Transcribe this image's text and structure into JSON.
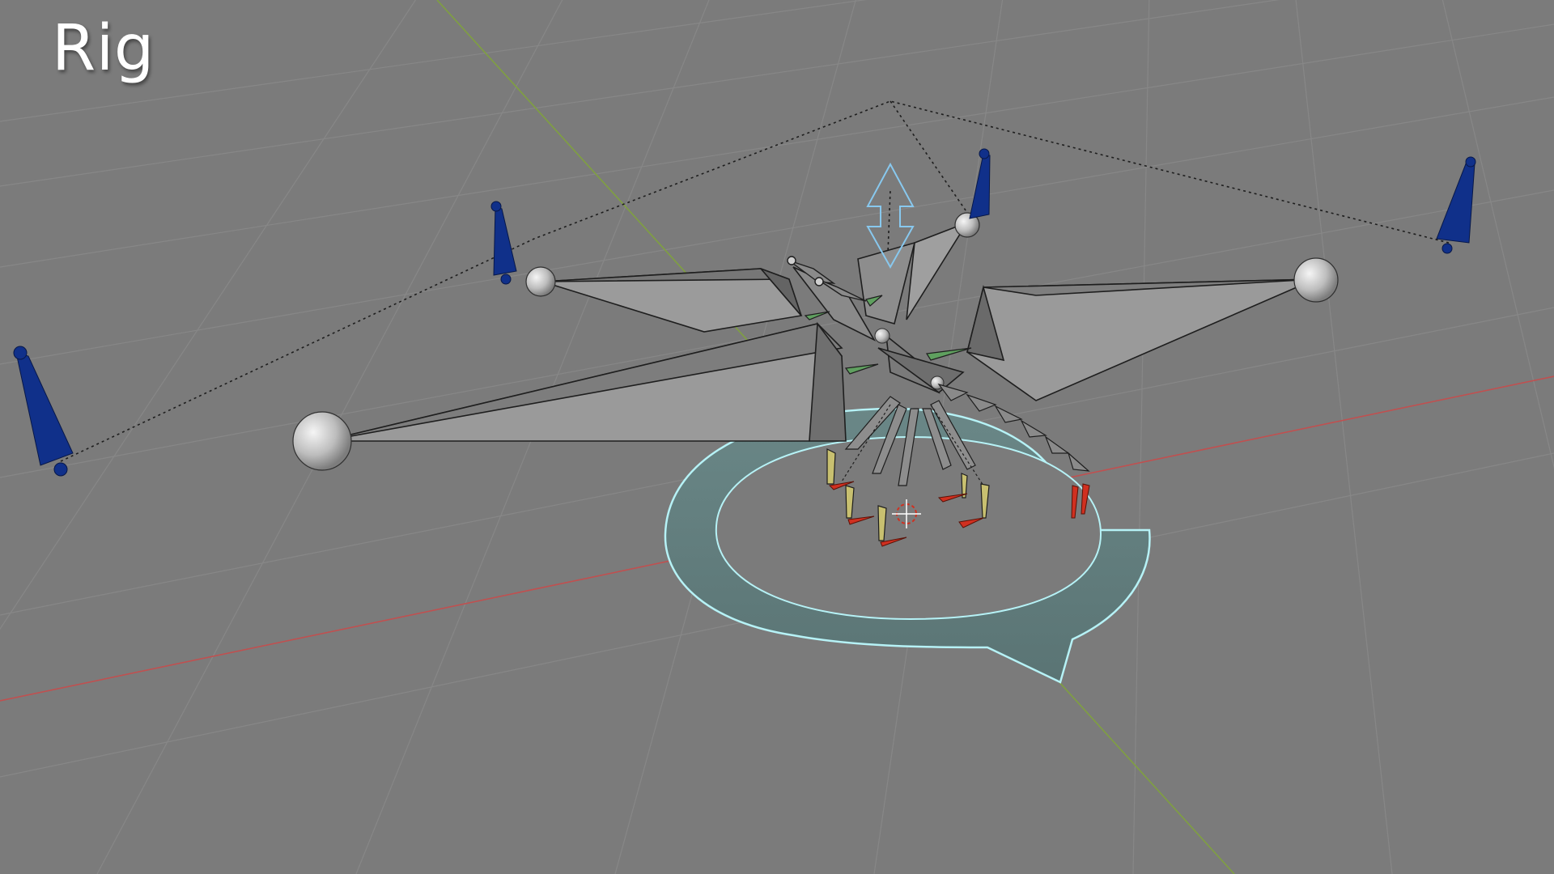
{
  "viewport": {
    "title": "Rig"
  },
  "colors": {
    "background": "#7b7b7b",
    "grid": "#8a8a8a",
    "x_axis": "#c05050",
    "y_axis": "#7fa040",
    "bone": "#8c8c8c",
    "bone_dark": "#5f5f5f",
    "joint": "#d8d8d8",
    "ik_target": "#10308a",
    "foot_control": "#d03020",
    "leg_bone": "#c8c070",
    "spine_accent": "#5fa05f",
    "root_ring": "#5e7a7a",
    "root_ring_edge": "#b6f2f6",
    "gizmo": "#88c8ee"
  },
  "icons": {
    "transform_gizmo": "arrow-up-down-icon",
    "origin": "crosshair-origin-icon"
  }
}
